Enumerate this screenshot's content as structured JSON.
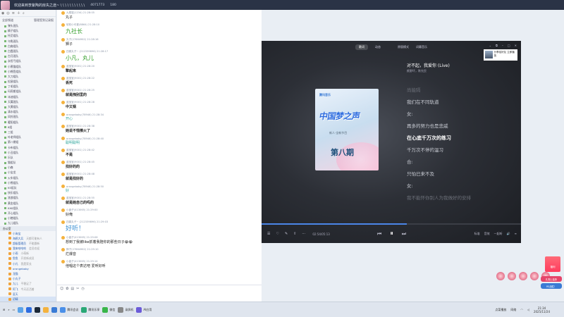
{
  "titlebar": {
    "title": "欢迎来到李紫陶的房失之途~ \\ \\ \\ \\ \\ \\ \\ \\ \\ \\ \\",
    "room_id": "4071773",
    "viewers": "180",
    "buttons": [
      "home-icon",
      "gamepad-icon",
      "tv-icon",
      "chat-icon",
      "settings-icon",
      "minimize-icon",
      "maximize-icon",
      "close-icon"
    ]
  },
  "sidebar": {
    "header_left": "全部频道",
    "header_right": "管理签到记录报",
    "groups": [
      "弹头班队",
      "精子组队",
      "托尼组队",
      "乌龟班队",
      "白肩组队",
      "白霞班队",
      "古月班队",
      "永恒弓组队",
      "小黑猫组队",
      "小棉签组队",
      "大刀组队",
      "松鼠组队",
      "丁毛组队",
      "玛莉斯组队",
      "冰迪组队",
      "天翼班队",
      "大黄组队",
      "清水组队",
      "风铃班队",
      "暖阳组队",
      "8组",
      "三组",
      "叶老师组队",
      "第八期组",
      "卡布组队",
      "小丑组队",
      "乐队",
      "猫组队",
      "小森",
      "小宝龙",
      "火车组队",
      "小熊组队",
      "KS组队",
      "快乐组队",
      "流浪组队",
      "黄金组队",
      "KIKI组队",
      "开心组队",
      "小猪组队",
      "九儿组队"
    ],
    "section": "办公室",
    "members": [
      {
        "name": "小淘宝",
        "note": ""
      },
      {
        "name": "海鸥大兵",
        "note": "天都可能有人"
      },
      {
        "name": "超级管理员",
        "note": "不能跟新"
      },
      {
        "name": "我来哈哈哈",
        "note": "会员欢迎"
      },
      {
        "name": "小雨",
        "note": "小萌新"
      },
      {
        "name": "鱼鱼",
        "note": "开发新成员"
      },
      {
        "name": "小凡",
        "note": "我是家长"
      },
      {
        "name": "orangebaby",
        "note": ""
      },
      {
        "name": "龙猫",
        "note": ""
      },
      {
        "name": "小丸子",
        "note": ""
      },
      {
        "name": "九儿",
        "note": "平稳足了"
      },
      {
        "name": "阿飞",
        "note": "今天还活着"
      },
      {
        "name": "夏天",
        "note": ""
      },
      {
        "name": "初晴",
        "note": ""
      },
      {
        "name": "小鹿",
        "note": ""
      },
      {
        "name": "花园管理员",
        "note": "大家都来到"
      },
      {
        "name": "彩虹小海豚",
        "note": "永远的心"
      },
      {
        "name": "某小鬼",
        "note": ""
      }
    ]
  },
  "chat": {
    "messages": [
      {
        "meta": "九尾狐(1234) 21:28:05",
        "text": "丸子",
        "style": ""
      },
      {
        "meta": "软软小可爱(8864) 21:28:10",
        "text": "九社长",
        "style": "big"
      },
      {
        "meta": "丸子(27664962) 21:28:16",
        "text": "狮子",
        "style": ""
      },
      {
        "meta": "四喜丸子~ (212339896) 21:28:17",
        "text": "小凡，丸儿",
        "style": "big"
      },
      {
        "meta": "蓝宝宝(9001) 21:28:20",
        "text": "擎起来",
        "style": "bold"
      },
      {
        "meta": "蓝宝宝(9001) 21:28:22",
        "text": "丢死",
        "style": "bold"
      },
      {
        "meta": "蓝宝宝(9001) 21:28:25",
        "text": "就是拽别里的",
        "style": "bold"
      },
      {
        "meta": "蓝宝宝(9001) 21:28:28",
        "text": "中又锅",
        "style": "bold"
      },
      {
        "meta": "orangebaby(78946) 21:28:34",
        "text": "开心",
        "style": "teal"
      },
      {
        "meta": "蓝宝宝(9001) 21:28:38",
        "text": "她说不惜擦火了",
        "style": "bold"
      },
      {
        "meta": "orangebaby(78946) 21:28:40",
        "text": "聪明聪明",
        "style": "teal"
      },
      {
        "meta": "蓝宝宝(9001) 21:28:42",
        "text": "不是",
        "style": "bold"
      },
      {
        "meta": "蓝宝宝(9001) 21:28:45",
        "text": "找好的的",
        "style": "bold"
      },
      {
        "meta": "蓝宝宝(9001) 21:28:48",
        "text": "就是找好的",
        "style": "bold"
      },
      {
        "meta": "orangebaby(78946) 21:28:50",
        "text": "好",
        "style": "teal"
      },
      {
        "meta": "蓝宝宝(9001) 21:28:55",
        "text": "就是她自己的吗的",
        "style": "bold"
      },
      {
        "meta": "小鑫子(413065) 21:29:00",
        "text": "好俺",
        "style": ""
      },
      {
        "meta": "四喜丸子~ (212339896) 21:29:03",
        "text": "好听！",
        "style": "big2"
      },
      {
        "meta": "小鑫子(413065) 21:29:06",
        "text": "想到了我被like抓着我陪你的那些日子😭😭",
        "style": ""
      },
      {
        "meta": "狮子(27664962) 21:29:10",
        "text": "烂爆音",
        "style": ""
      },
      {
        "meta": "小鑫子(413065) 21:29:14",
        "text": "他唱这个表达吧 爱听好听",
        "style": ""
      }
    ]
  },
  "input": {
    "icons": [
      "emoji-icon",
      "gift-icon",
      "image-icon",
      "scissors-icon",
      "history-icon"
    ]
  },
  "player": {
    "tabs": [
      "歌词",
      "动态"
    ],
    "active_tab": "歌词",
    "options": [
      "原版模式",
      "词幕音乐"
    ],
    "song_title": "对不起，我爱你 (Live)",
    "artist": "颜野坏，陈先民",
    "cover_logo": "腾讯音乐",
    "cover_title": "中国梦之声",
    "cover_episode": "第八期",
    "cover_sub": "新人·全新节目",
    "lyrics": [
      {
        "text": "尚能隔",
        "state": "dim"
      },
      {
        "text": "我们在不同轨道",
        "state": ""
      },
      {
        "text": "女:",
        "state": ""
      },
      {
        "text": "再多的努力也是悲戚",
        "state": ""
      },
      {
        "text": "在心底千万次的练习",
        "state": "cur"
      },
      {
        "text": "千万次不停的温习",
        "state": ""
      },
      {
        "text": "合:",
        "state": ""
      },
      {
        "text": "只怕已来不及",
        "state": ""
      },
      {
        "text": "女:",
        "state": ""
      },
      {
        "text": "我不能怀你别人为我做好的安排",
        "state": "dim"
      }
    ],
    "time": "02:54/05:13",
    "progress": 0.56,
    "right_labels": [
      "标准",
      "音效",
      "一起听"
    ],
    "share_text": "分享给好友 立即播放"
  },
  "side_buttons": {
    "gift1": "礼物上装饰",
    "gift2": "RS战胜！",
    "promo": "福利"
  },
  "taskbar": {
    "items": [
      "腾讯会议",
      "腾讯乐享",
      "微信",
      "录屏机",
      "AI应用"
    ],
    "tray": [
      "点菜播放",
      "网络"
    ],
    "time": "21:34",
    "date": "2025/11/24"
  }
}
